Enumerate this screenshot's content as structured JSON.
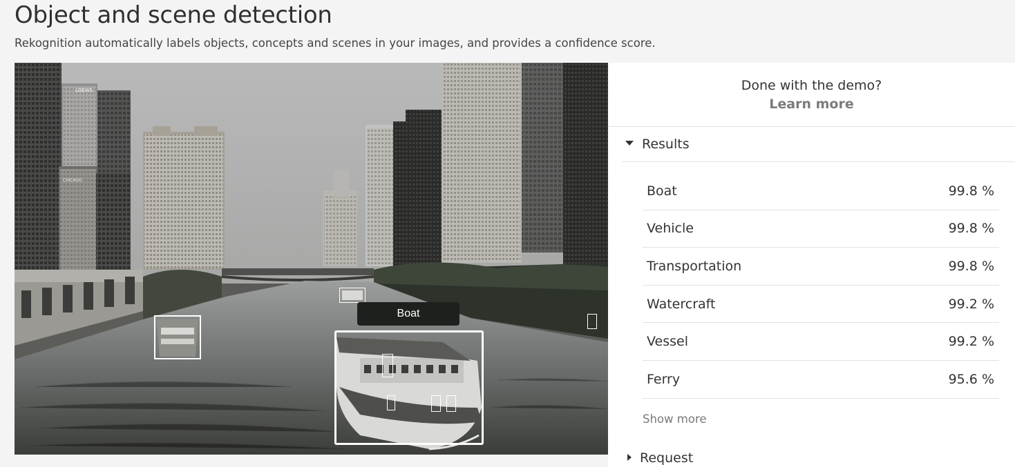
{
  "header": {
    "title": "Object and scene detection",
    "subtitle": "Rekognition automatically labels objects, concepts and scenes in your images, and provides a confidence score."
  },
  "image": {
    "highlight_label": "Boat",
    "signage": {
      "sign1": "LOEWS",
      "sign2": "CHICAGO"
    }
  },
  "panel": {
    "demo_question": "Done with the demo?",
    "learn_more": "Learn more",
    "results_heading": "Results",
    "results": [
      {
        "label": "Boat",
        "confidence": "99.8 %"
      },
      {
        "label": "Vehicle",
        "confidence": "99.8 %"
      },
      {
        "label": "Transportation",
        "confidence": "99.8 %"
      },
      {
        "label": "Watercraft",
        "confidence": "99.2 %"
      },
      {
        "label": "Vessel",
        "confidence": "99.2 %"
      },
      {
        "label": "Ferry",
        "confidence": "95.6 %"
      }
    ],
    "show_more": "Show more",
    "request_heading": "Request"
  },
  "colors": {
    "panel_bg": "#ffffff",
    "page_bg": "#f4f4f4",
    "label_tag_bg": "#1e201d",
    "box_stroke": "#ffffff"
  }
}
